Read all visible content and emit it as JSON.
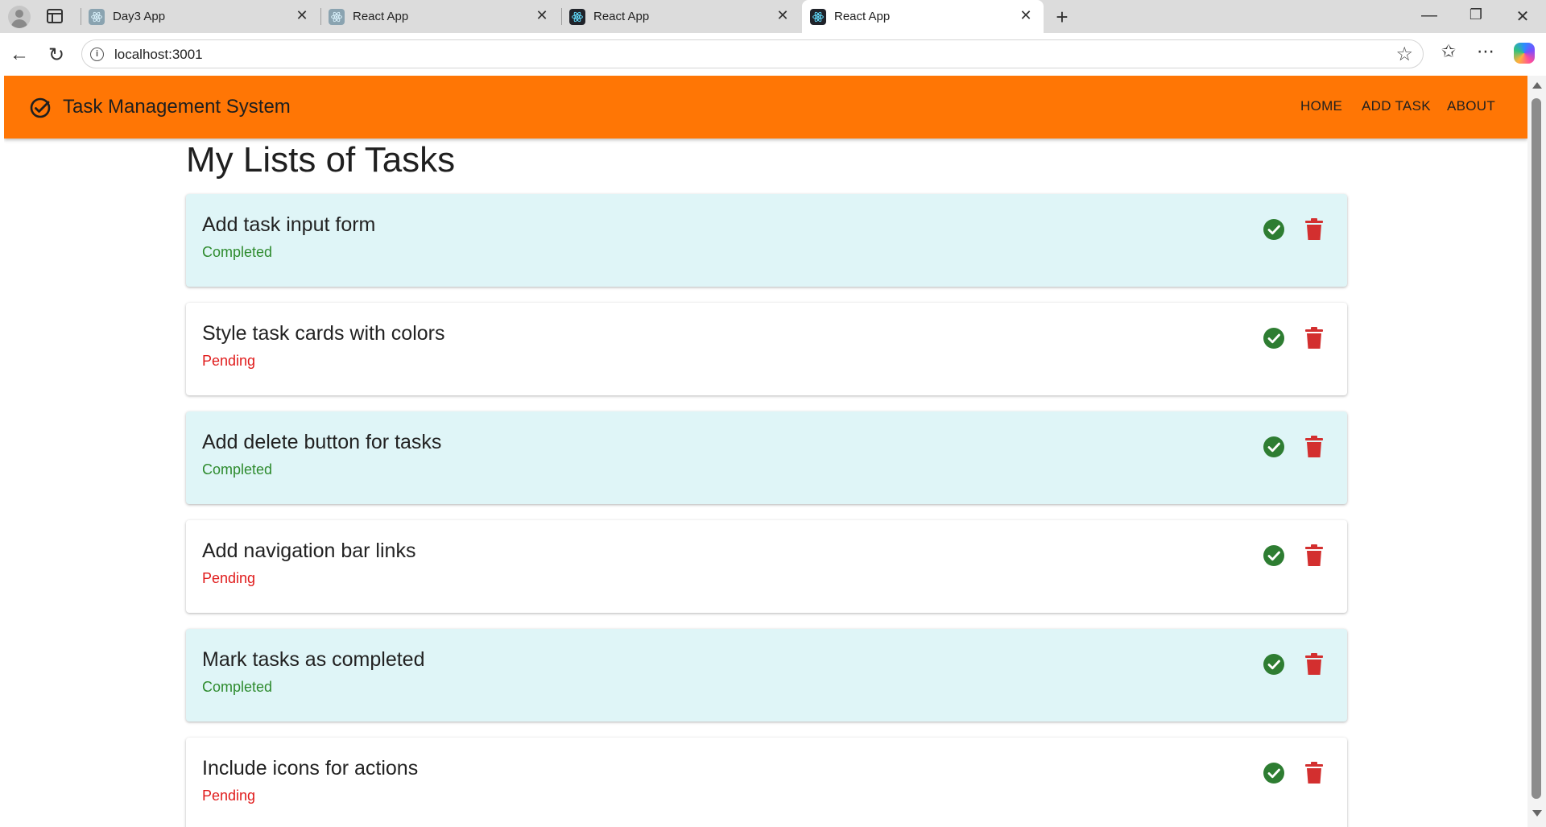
{
  "browser": {
    "tabs": [
      {
        "title": "Day3 App",
        "active": false
      },
      {
        "title": "React App",
        "active": false
      },
      {
        "title": "React App",
        "active": false
      },
      {
        "title": "React App",
        "active": true
      }
    ],
    "url": "localhost:3001"
  },
  "app": {
    "brand": "Task Management System",
    "nav": {
      "home": "HOME",
      "add_task": "ADD TASK",
      "about": "ABOUT"
    },
    "heading": "My Lists of Tasks"
  },
  "tasks": [
    {
      "title": "Add task input form",
      "status": "Completed"
    },
    {
      "title": "Style task cards with colors",
      "status": "Pending"
    },
    {
      "title": "Add delete button for tasks",
      "status": "Completed"
    },
    {
      "title": "Add navigation bar links",
      "status": "Pending"
    },
    {
      "title": "Mark tasks as completed",
      "status": "Completed"
    },
    {
      "title": "Include icons for actions",
      "status": "Pending"
    }
  ],
  "colors": {
    "appbar": "#ff7605",
    "completed_text": "#2e8b2e",
    "pending_text": "#e01b1b",
    "completed_card": "#dff5f7",
    "check_icon": "#2e7d32",
    "trash_icon": "#d32f2f"
  },
  "icons": {
    "logo": "check-circle-outline-icon",
    "complete": "check-circle-icon",
    "delete": "trash-icon"
  }
}
